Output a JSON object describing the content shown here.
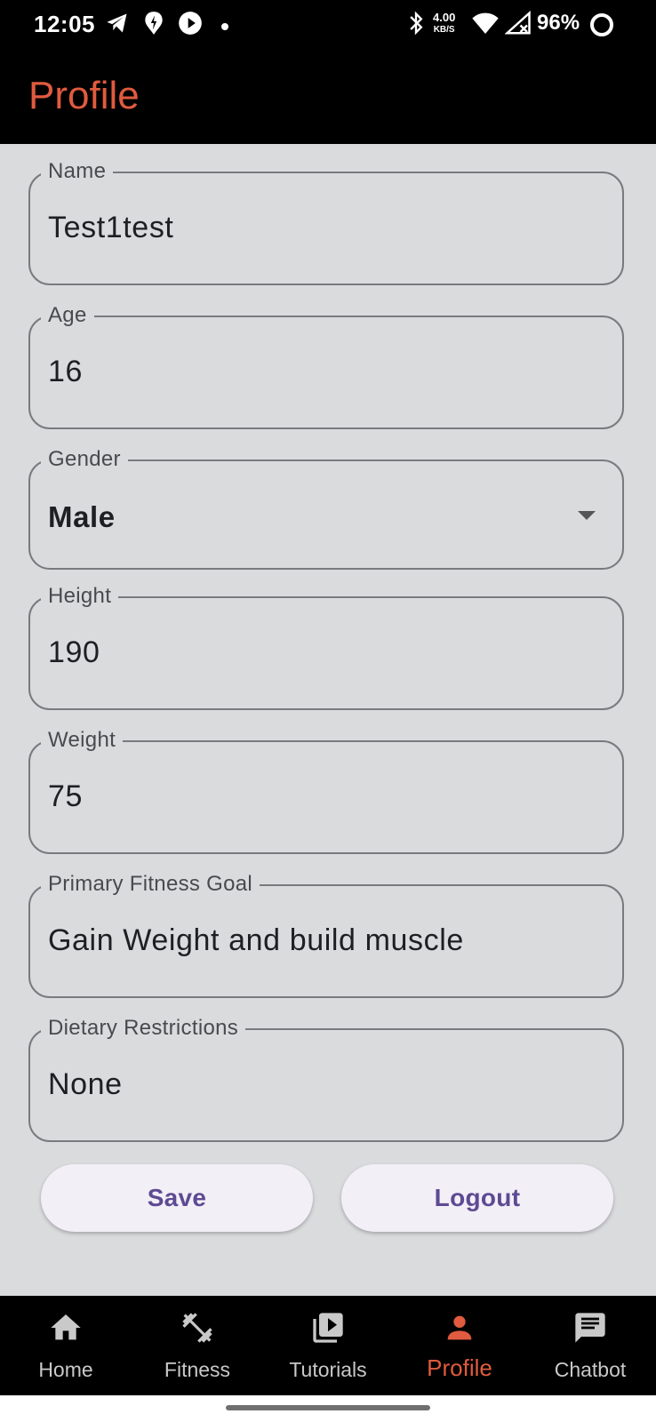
{
  "status_bar": {
    "time": "12:05",
    "net_speed_value": "4.00",
    "net_speed_unit": "KB/S",
    "battery": "96%"
  },
  "app_bar": {
    "title": "Profile"
  },
  "form": {
    "name": {
      "label": "Name",
      "value": "Test1test"
    },
    "age": {
      "label": "Age",
      "value": "16"
    },
    "gender": {
      "label": "Gender",
      "value": "Male"
    },
    "height": {
      "label": "Height",
      "value": "190"
    },
    "weight": {
      "label": "Weight",
      "value": "75"
    },
    "goal": {
      "label": "Primary Fitness Goal",
      "value": "Gain Weight and build muscle"
    },
    "diet": {
      "label": "Dietary Restrictions",
      "value": "None"
    }
  },
  "actions": {
    "save_label": "Save",
    "logout_label": "Logout"
  },
  "nav": {
    "items": [
      {
        "label": "Home",
        "icon": "home-icon"
      },
      {
        "label": "Fitness",
        "icon": "dumbbell-icon"
      },
      {
        "label": "Tutorials",
        "icon": "video-library-icon"
      },
      {
        "label": "Profile",
        "icon": "person-icon",
        "active": true
      },
      {
        "label": "Chatbot",
        "icon": "chat-icon"
      }
    ]
  },
  "colors": {
    "accent": "#e05b3f",
    "button_text": "#5e4a93",
    "background": "#dadbdd"
  }
}
